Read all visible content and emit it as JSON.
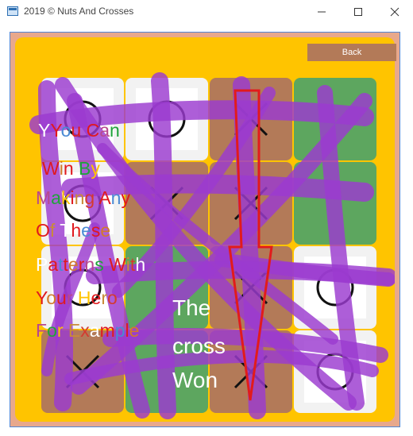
{
  "window": {
    "title": "2019 © Nuts And Crosses",
    "controls": [
      "minimize",
      "maximize",
      "close"
    ]
  },
  "back_button": {
    "label": "Back"
  },
  "board": {
    "size": 4,
    "colors": {
      "white": "#f2f2f2",
      "brown": "#b37a58",
      "green": "#5da65f",
      "panel": "#ffc400",
      "scribble": "#9b3ad0",
      "arrow": "#e21b1b"
    },
    "cells": [
      {
        "color": "white",
        "mark": "O"
      },
      {
        "color": "white",
        "mark": "O"
      },
      {
        "color": "brown",
        "mark": "X"
      },
      {
        "color": "green",
        "mark": ""
      },
      {
        "color": "white",
        "mark": "O"
      },
      {
        "color": "brown",
        "mark": "X"
      },
      {
        "color": "brown",
        "mark": "X"
      },
      {
        "color": "green",
        "mark": ""
      },
      {
        "color": "white",
        "mark": "O"
      },
      {
        "color": "green",
        "mark": ""
      },
      {
        "color": "brown",
        "mark": "X"
      },
      {
        "color": "white",
        "mark": "O"
      },
      {
        "color": "brown",
        "mark": "X"
      },
      {
        "color": "green",
        "mark": ""
      },
      {
        "color": "brown",
        "mark": "X"
      },
      {
        "color": "white",
        "mark": "O"
      }
    ]
  },
  "hint": {
    "lines": [
      "YYou Can",
      "Win By",
      "Making Any",
      "Of These",
      "Patterns With",
      "Your Hero",
      "For Example"
    ]
  },
  "result": {
    "lines": [
      "The",
      "cross",
      "Won"
    ]
  }
}
